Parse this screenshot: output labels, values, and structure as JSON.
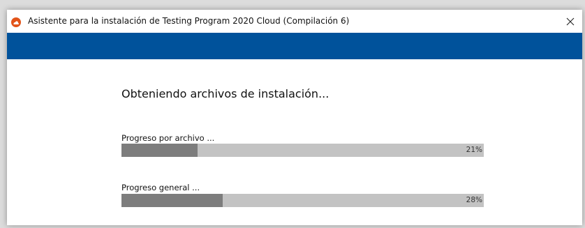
{
  "window": {
    "title": "Asistente para la instalación de Testing Program 2020 Cloud (Compilación 6)",
    "header_color": "#00529b"
  },
  "icons": {
    "app": "app-logo-icon",
    "close": "close-icon"
  },
  "main": {
    "status": "Obteniendo archivos de instalación...",
    "file_progress": {
      "label": "Progreso por archivo ...",
      "percent_text": "21%",
      "value": 0.21
    },
    "overall_progress": {
      "label": "Progreso general ...",
      "percent_text": "28%",
      "value": 0.28
    }
  },
  "colors": {
    "track": "#c3c3c3",
    "fill": "#7d7d7d",
    "app_icon": "#e2541a"
  }
}
